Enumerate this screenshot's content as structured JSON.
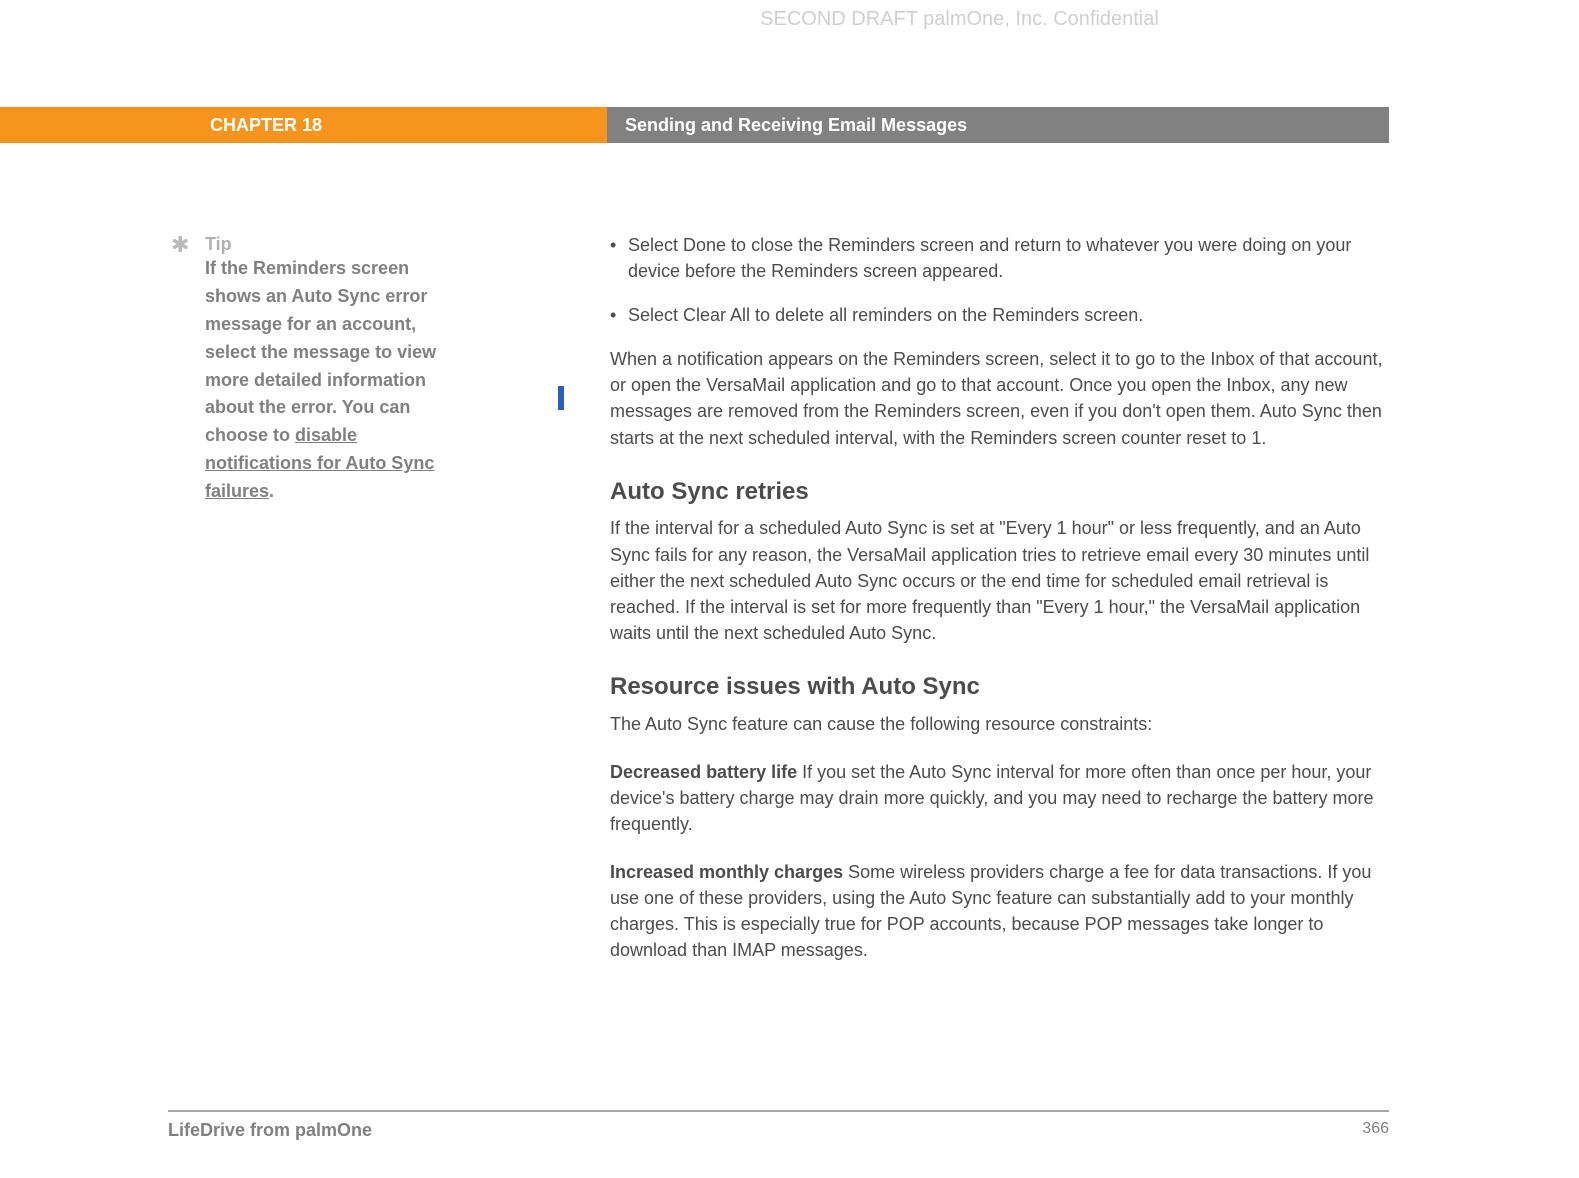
{
  "confidential": "SECOND DRAFT palmOne, Inc.  Confidential",
  "header": {
    "chapter": "CHAPTER 18",
    "title": "Sending and Receiving Email Messages"
  },
  "sidebar": {
    "tip_label": "Tip",
    "tip_text_before": "If the Reminders screen shows an Auto Sync error message for an account, select the message to view more detailed information about the error. You can choose to ",
    "tip_link": "disable notifications for Auto Sync failures",
    "tip_text_after": "."
  },
  "main": {
    "bullet1": "Select Done to close the Reminders screen and return to whatever you were doing on your device before the Reminders screen appeared.",
    "bullet2": "Select Clear All to delete all reminders on the Reminders screen.",
    "para1": "When a notification appears on the Reminders screen, select it to go to the Inbox of that account, or open the VersaMail application and go to that account. Once you open the Inbox, any new messages are removed from the Reminders screen, even if you don't open them. Auto Sync then starts at the next scheduled interval, with the Reminders screen counter reset to 1.",
    "h2a": "Auto Sync retries",
    "para2": "If the interval for a scheduled Auto Sync is set at \"Every 1 hour\" or less frequently, and an Auto Sync fails for any reason, the VersaMail application tries to retrieve email every 30 minutes until either the next scheduled Auto Sync occurs or the end time for scheduled email retrieval is reached. If the interval is set for more frequently than \"Every 1 hour,\" the VersaMail application waits until the next scheduled Auto Sync.",
    "h2b": "Resource issues with Auto Sync",
    "para3": "The Auto Sync feature can cause the following resource constraints:",
    "p4_bold": "Decreased battery life",
    "p4_rest": "   If you set the Auto Sync interval for more often than once per hour, your device's battery charge may drain more quickly, and you may need to recharge the battery more frequently.",
    "p5_bold": "Increased monthly charges",
    "p5_rest": "   Some wireless providers charge a fee for data transactions. If you use one of these providers, using the Auto Sync feature can substantially add to your monthly charges. This is especially true for POP accounts, because POP messages take longer to download than IMAP messages."
  },
  "footer": {
    "product": "LifeDrive from palmOne",
    "page": "366"
  }
}
